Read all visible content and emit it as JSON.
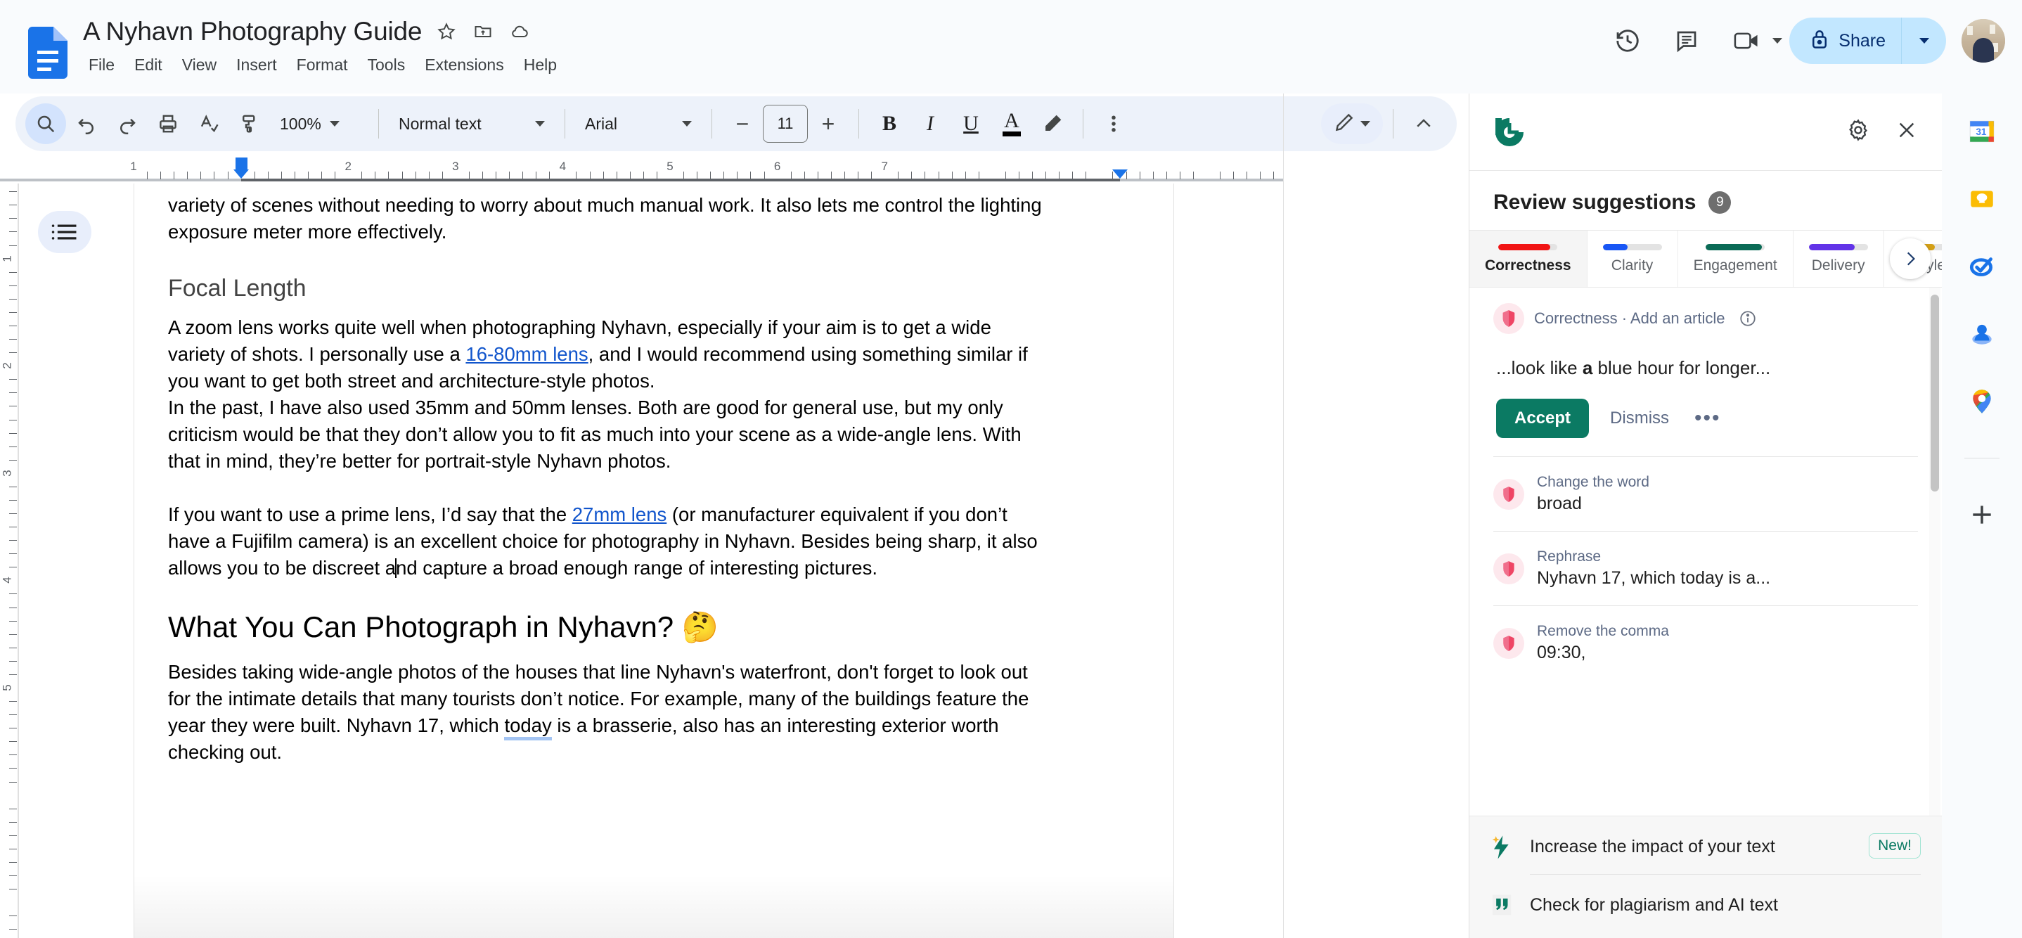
{
  "app": {
    "doc_title": "A Nyhavn Photography Guide",
    "menu": [
      "File",
      "Edit",
      "View",
      "Insert",
      "Format",
      "Tools",
      "Extensions",
      "Help"
    ],
    "title_icons": [
      "star-icon",
      "move-to-folder-icon",
      "cloud-saved-icon"
    ],
    "header_actions": [
      "version-history-icon",
      "comment-icon",
      "meet-camera-icon"
    ],
    "share_label": "Share",
    "share_lock_icon": "lock-icon"
  },
  "toolbar": {
    "search_icon": "search-icon",
    "undo_icon": "undo-icon",
    "redo_icon": "redo-icon",
    "print_icon": "print-icon",
    "spellcheck_icon": "spellcheck-icon",
    "paint_format_icon": "paint-format-icon",
    "zoom_value": "100%",
    "paragraph_style": "Normal text",
    "font_family": "Arial",
    "font_size": "11",
    "decrease_font": "−",
    "increase_font": "+",
    "bold": "B",
    "italic": "I",
    "underline": "U",
    "text_color": "A",
    "highlight_icon": "highlight-pen-icon",
    "more_icon": "more-vertical-icon",
    "editing_mode_icon": "edit-pencil-icon",
    "collapse_icon": "chevron-up-icon"
  },
  "ruler": {
    "horizontal_numbers": [
      "1",
      "1",
      "2",
      "3",
      "4",
      "5",
      "6",
      "7"
    ],
    "vertical_numbers": [
      "1",
      "2",
      "3",
      "4",
      "5"
    ]
  },
  "document": {
    "outline_icon": "document-outline-icon",
    "blocks": [
      {
        "type": "paragraph",
        "runs": [
          {
            "t": "variety of scenes without needing to worry about much manual work. It also lets me control the lighting exposure meter more effectively."
          }
        ]
      },
      {
        "type": "spacer"
      },
      {
        "type": "heading2",
        "text": "Focal Length"
      },
      {
        "type": "paragraph",
        "runs": [
          {
            "t": "A zoom lens works quite well when photographing Nyhavn, especially if your aim is to get a wide variety of shots. I personally use a "
          },
          {
            "t": "16-80mm lens",
            "style": "link"
          },
          {
            "t": ", and I would recommend using something similar if you want to get both street and architecture-style photos."
          }
        ]
      },
      {
        "type": "paragraph",
        "runs": [
          {
            "t": "In the past, I have also used 35mm and 50mm lenses. Both are good for general use, but my only criticism would be that they don’t allow you to fit as much into your scene as a wide-angle lens. With that in mind, they’re better for portrait-style Nyhavn photos."
          }
        ]
      },
      {
        "type": "spacer"
      },
      {
        "type": "paragraph",
        "runs": [
          {
            "t": "If you want to use a prime lens, I’d say that the "
          },
          {
            "t": "27mm lens",
            "style": "link"
          },
          {
            "t": " (or manufacturer equivalent if you don’t have a Fujifilm camera) is an excellent choice for photography in Nyhavn. Besides being sharp, it also allows you to be discreet a"
          },
          {
            "t": "",
            "style": "caret"
          },
          {
            "t": "nd capture a broad enough range of interesting pictures."
          }
        ]
      },
      {
        "type": "spacer"
      },
      {
        "type": "heading1",
        "text": "What You Can Photograph in Nyhavn? 🤔"
      },
      {
        "type": "paragraph",
        "runs": [
          {
            "t": "Besides taking wide-angle photos of the houses that line Nyhavn's waterfront, don't forget to look out for the intimate details that many tourists don’t notice. For example, many of the buildings feature the year they were built. Nyhavn 17, which "
          },
          {
            "t": "today",
            "style": "grammarly"
          },
          {
            "t": " is a brasserie, also has an interesting exterior worth checking out."
          }
        ]
      }
    ]
  },
  "grammarly": {
    "logo_icon": "grammarly-logo-icon",
    "settings_icon": "gear-icon",
    "close_icon": "close-icon",
    "panel_title": "Review suggestions",
    "suggestion_count": "9",
    "tabs": [
      {
        "label": "Correctness",
        "color": "#f11414",
        "fill": 88,
        "selected": true
      },
      {
        "label": "Clarity",
        "color": "#1856f5",
        "fill": 42,
        "selected": false
      },
      {
        "label": "Engagement",
        "color": "#0b6b56",
        "fill": 95,
        "selected": false
      },
      {
        "label": "Delivery",
        "color": "#6233e8",
        "fill": 78,
        "selected": false
      },
      {
        "label": "Style",
        "color": "#d4a017",
        "fill": 60,
        "selected": false
      }
    ],
    "next_tab_icon": "chevron-right-icon",
    "card": {
      "category": "Correctness · Add an article",
      "info_icon": "info-icon",
      "shield_icon": "shield-icon",
      "preview_prefix": "...look like ",
      "preview_bold": "a",
      "preview_suffix": " blue hour for longer...",
      "accept_label": "Accept",
      "dismiss_label": "Dismiss",
      "more_label": "•••"
    },
    "suggestions": [
      {
        "label": "Change the word",
        "value": "broad",
        "icon": "shield-icon"
      },
      {
        "label": "Rephrase",
        "value": "Nyhavn 17, which today is a...",
        "icon": "shield-icon"
      },
      {
        "label": "Remove the comma",
        "value": "09:30,",
        "icon": "shield-icon"
      }
    ],
    "footer": [
      {
        "label": "Increase the impact of your text",
        "badge": "New!",
        "icon": "bolt-icon"
      },
      {
        "label": "Check for plagiarism and AI text",
        "badge": "",
        "icon": "quote-icon"
      }
    ]
  },
  "rail": {
    "icons": [
      "google-calendar-icon",
      "google-keep-icon",
      "google-tasks-icon",
      "contacts-icon",
      "google-maps-icon",
      "add-apps-icon"
    ]
  }
}
